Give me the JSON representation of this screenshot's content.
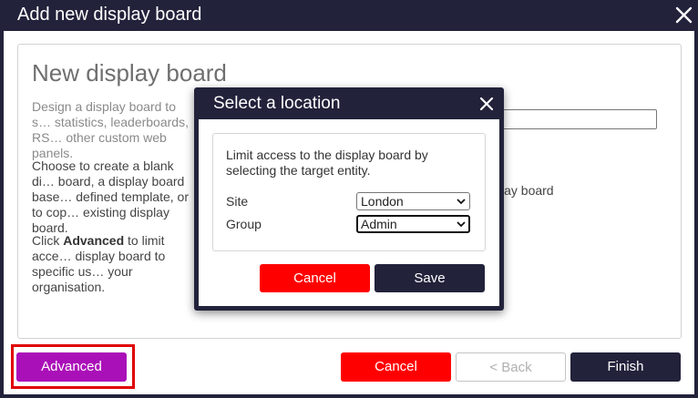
{
  "outer": {
    "title": "Add new display board",
    "close_icon": "close-icon"
  },
  "page": {
    "heading": "New display board",
    "paragraph1": "Design a display board to s… statistics, leaderboards, RS… other custom web panels.",
    "paragraph2": "Choose to create a blank di… board, a display board base… defined template, or to cop… existing display board.",
    "paragraph3_prefix": "Click ",
    "paragraph3_bold": "Advanced",
    "paragraph3_suffix": " to limit acce… display board to specific us… your organisation.",
    "option_fragment": "lay board"
  },
  "footer": {
    "advanced_label": "Advanced",
    "cancel_label": "Cancel",
    "back_label": "< Back",
    "finish_label": "Finish"
  },
  "modal": {
    "title": "Select a location",
    "description": "Limit access to the display board by selecting the target entity.",
    "site_label": "Site",
    "site_value": "London",
    "group_label": "Group",
    "group_value": "Admin",
    "cancel_label": "Cancel",
    "save_label": "Save"
  },
  "colors": {
    "titlebar": "#22223b",
    "advanced": "#aa10b8",
    "cancel": "#ff0000",
    "highlight": "#e00000"
  }
}
